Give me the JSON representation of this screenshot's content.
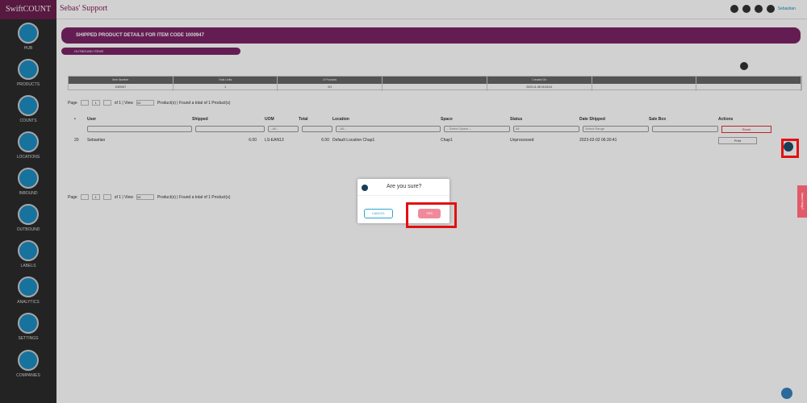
{
  "brand": "SwiftCOUNT",
  "header": {
    "title": "Sebas' Support",
    "user": "Sebastian"
  },
  "sidebar": [
    {
      "label": "HUB",
      "icon": "hub-icon"
    },
    {
      "label": "PRODUCTS",
      "icon": "box-icon"
    },
    {
      "label": "COUNTS",
      "icon": "counter-icon"
    },
    {
      "label": "LOCATIONS",
      "icon": "location-icon"
    },
    {
      "label": "INBOUND",
      "icon": "truck-in-icon"
    },
    {
      "label": "OUTBOUND",
      "icon": "truck-out-icon"
    },
    {
      "label": "LABELS",
      "icon": "label-icon"
    },
    {
      "label": "ANALYTICS",
      "icon": "chart-icon"
    },
    {
      "label": "SETTINGS",
      "icon": "gear-icon"
    },
    {
      "label": "COMPANIES",
      "icon": "building-icon"
    }
  ],
  "banner": "SHIPPED PRODUCT DETAILS FOR ITEM CODE 1000947",
  "subbanner": "OUTBOUND ITEMS",
  "summary": {
    "headers": [
      "Item Number",
      "Total Units",
      "# Products",
      "",
      "Created On",
      "",
      ""
    ],
    "values": [
      "1000947",
      "1",
      "0/1",
      "",
      "2023-11-08 16:43:41",
      "",
      ""
    ]
  },
  "pager": {
    "page": "1",
    "of": "of 1 | View",
    "view": "10",
    "found": "Product(s) | Found a total of 1 Product(s)"
  },
  "table": {
    "headers": [
      "User",
      "Shipped",
      "UOM",
      "Total",
      "Location",
      "Space",
      "Status",
      "Date Shipped",
      "Sale Box",
      "Actions"
    ],
    "filters": {
      "uom": "--All--",
      "location": "--All--",
      "space": "-- Select Space --",
      "status": "All",
      "date": "Select Range"
    },
    "reset": "Reset",
    "rows": [
      {
        "id": "20",
        "user": "Sebastian",
        "shipped": "6.00",
        "uom": "LS-EAN13",
        "total": "6.00",
        "location": "Default Location Chap1",
        "space": "Chap1",
        "status": "Unprocessed",
        "date": "2023-02-02 06:30:41",
        "action": "Print"
      }
    ]
  },
  "modal": {
    "message": "Are you sure?",
    "cancel": "CANCEL",
    "yes": "YES"
  },
  "feedback": "Need Help?"
}
